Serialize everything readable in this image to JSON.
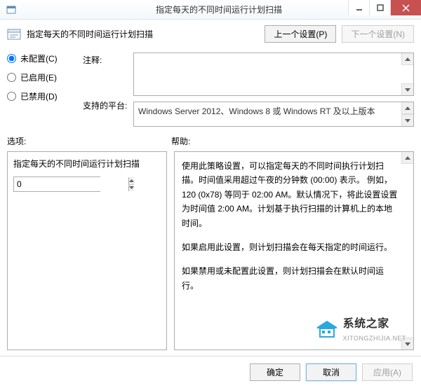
{
  "window": {
    "title": "指定每天的不同时间运行计划扫描"
  },
  "header": {
    "label": "指定每天的不同时间运行计划扫描",
    "prev_btn": "上一个设置(P)",
    "next_btn": "下一个设置(N)"
  },
  "config_state": {
    "unconfigured": "未配置(C)",
    "enabled": "已启用(E)",
    "disabled": "已禁用(D)",
    "selected": "unconfigured"
  },
  "labels": {
    "comment": "注释:",
    "platform": "支持的平台:",
    "options": "选项:",
    "help": "帮助:"
  },
  "comment_value": "",
  "platform_text": "Windows Server 2012、Windows 8 或 Windows RT 及以上版本",
  "option_title": "指定每天的不同时间运行计划扫描",
  "option_value": "0",
  "help": {
    "p1": "使用此策略设置，可以指定每天的不同时间执行计划扫描。时间值采用超过午夜的分钟数 (00:00) 表示。 例如，120 (0x78) 等同于 02:00 AM。默认情况下，将此设置设置为时间值 2:00 AM。计划基于执行扫描的计算机上的本地时间。",
    "p2": "如果启用此设置，则计划扫描会在每天指定的时间运行。",
    "p3": "如果禁用或未配置此设置，则计划扫描会在默认时间运行。"
  },
  "watermark": {
    "zh": "系统之家",
    "en": "XITONGZHIJIA.NET"
  },
  "footer": {
    "ok": "确定",
    "cancel": "取消",
    "apply": "应用(A)"
  }
}
